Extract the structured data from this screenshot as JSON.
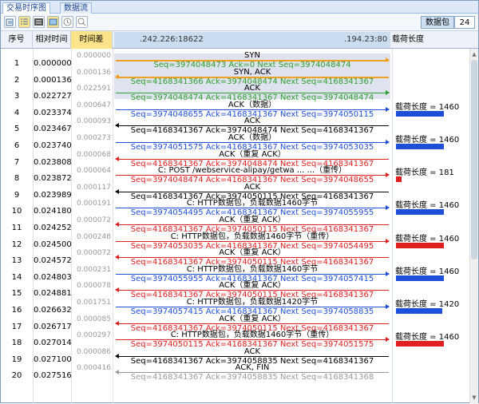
{
  "tabs": [
    {
      "label": "交易时序图",
      "active": true
    },
    {
      "label": "数据流",
      "active": false
    }
  ],
  "toolbar": {
    "icons": [
      "export-icon",
      "list-icon",
      "hex-icon",
      "image-icon",
      "clock-icon",
      "search-icon"
    ],
    "packet_label": "数据包",
    "packet_count": "24"
  },
  "columns": {
    "seq": "序号",
    "rel_time": "相对时间",
    "delta_time": "时间差",
    "left_ip": ".242.226:18622",
    "right_ip": ".194.23:80",
    "payload": "载荷长度"
  },
  "colors": {
    "orange": "#f0a020",
    "green": "#2e9e2e",
    "blue": "#1f4fd8",
    "black": "#000000",
    "red": "#e02020",
    "gray": "#9a9a9a"
  },
  "rows": [
    {
      "no": "1",
      "rel": "0.000000",
      "delta": "0.000000"
    },
    {
      "no": "2",
      "rel": "0.000136",
      "delta": "0.000136"
    },
    {
      "no": "3",
      "rel": "0.022727",
      "delta": "0.022591"
    },
    {
      "no": "4",
      "rel": "0.023374",
      "delta": "0.000647"
    },
    {
      "no": "5",
      "rel": "0.023467",
      "delta": "0.000093"
    },
    {
      "no": "6",
      "rel": "0.023740",
      "delta": "0.000273"
    },
    {
      "no": "7",
      "rel": "0.023808",
      "delta": "0.000068"
    },
    {
      "no": "8",
      "rel": "0.023872",
      "delta": "0.000064"
    },
    {
      "no": "9",
      "rel": "0.023989",
      "delta": "0.000117"
    },
    {
      "no": "10",
      "rel": "0.024180",
      "delta": "0.000191"
    },
    {
      "no": "11",
      "rel": "0.024252",
      "delta": "0.000072"
    },
    {
      "no": "12",
      "rel": "0.024500",
      "delta": "0.000248"
    },
    {
      "no": "13",
      "rel": "0.024572",
      "delta": "0.000072"
    },
    {
      "no": "14",
      "rel": "0.024803",
      "delta": "0.000231"
    },
    {
      "no": "15",
      "rel": "0.024881",
      "delta": "0.000078"
    },
    {
      "no": "16",
      "rel": "0.026632",
      "delta": "0.001751"
    },
    {
      "no": "17",
      "rel": "0.026717",
      "delta": "0.000085"
    },
    {
      "no": "18",
      "rel": "0.027014",
      "delta": "0.000297"
    },
    {
      "no": "19",
      "rel": "0.027100",
      "delta": "0.000086"
    },
    {
      "no": "20",
      "rel": "0.027516",
      "delta": "0.000416"
    }
  ],
  "arrows": [
    {
      "dir": "right",
      "color": "orange",
      "top": "SYN",
      "bottom": "Seq=3974048473  Ack=0  Next Seq=3974048474",
      "bottom_color": "green"
    },
    {
      "dir": "left",
      "color": "orange",
      "top": "SYN, ACK",
      "bottom": "Seq=4168341366  Ack=3974048474  Next Seq=4168341367",
      "bottom_color": "green"
    },
    {
      "dir": "right",
      "color": "green",
      "top": "ACK",
      "bottom": "Seq=3974048474  Ack=4168341367  Next Seq=3974048474",
      "bottom_color": "green"
    },
    {
      "dir": "right",
      "color": "blue",
      "top": "ACK（数据）",
      "bottom": "Seq=3974048655  Ack=4168341367  Next Seq=3974050115",
      "bottom_color": "blue"
    },
    {
      "dir": "left",
      "color": "black",
      "top": "ACK",
      "bottom": "Seq=4168341367  Ack=3974048474  Next Seq=4168341367",
      "bottom_color": "black"
    },
    {
      "dir": "right",
      "color": "blue",
      "top": "ACK（数据）",
      "bottom": "Seq=3974051575  Ack=4168341367  Next Seq=3974053035",
      "bottom_color": "blue"
    },
    {
      "dir": "left",
      "color": "red",
      "top": "ACK（重复 ACK）",
      "bottom": "Seq=4168341367  Ack=3974048474  Next Seq=4168341367",
      "bottom_color": "red"
    },
    {
      "dir": "right",
      "color": "red",
      "top": "C: POST /webservice-alipay/getwa ... ...（重传）",
      "bottom": "Seq=3974048474  Ack=4168341367  Next Seq=3974048655",
      "bottom_color": "red"
    },
    {
      "dir": "left",
      "color": "black",
      "top": "ACK",
      "bottom": "Seq=4168341367  Ack=3974050115  Next Seq=4168341367",
      "bottom_color": "black"
    },
    {
      "dir": "right",
      "color": "blue",
      "top": "C: HTTP数据包，负载数据1460字节",
      "bottom": "Seq=3974054495  Ack=4168341367  Next Seq=3974055955",
      "bottom_color": "blue"
    },
    {
      "dir": "left",
      "color": "red",
      "top": "ACK（重复 ACK）",
      "bottom": "Seq=4168341367  Ack=3974050115  Next Seq=4168341367",
      "bottom_color": "red"
    },
    {
      "dir": "right",
      "color": "red",
      "top": "C: HTTP数据包，负载数据1460字节（重传）",
      "bottom": "Seq=3974053035  Ack=4168341367  Next Seq=3974054495",
      "bottom_color": "red"
    },
    {
      "dir": "left",
      "color": "red",
      "top": "ACK（重复 ACK）",
      "bottom": "Seq=4168341367  Ack=3974050115  Next Seq=4168341367",
      "bottom_color": "red"
    },
    {
      "dir": "right",
      "color": "blue",
      "top": "C: HTTP数据包，负载数据1460字节",
      "bottom": "Seq=3974055955  Ack=4168341367  Next Seq=3974057415",
      "bottom_color": "blue"
    },
    {
      "dir": "left",
      "color": "red",
      "top": "ACK（重复 ACK）",
      "bottom": "Seq=4168341367  Ack=3974050115  Next Seq=4168341367",
      "bottom_color": "red"
    },
    {
      "dir": "right",
      "color": "blue",
      "top": "C: HTTP数据包，负载数据1420字节",
      "bottom": "Seq=3974057415  Ack=4168341367  Next Seq=3974058835",
      "bottom_color": "blue"
    },
    {
      "dir": "left",
      "color": "red",
      "top": "ACK（重复 ACK）",
      "bottom": "Seq=4168341367  Ack=3974050115  Next Seq=4168341367",
      "bottom_color": "red"
    },
    {
      "dir": "right",
      "color": "red",
      "top": "C: HTTP数据包，负载数据1460字节（重传）",
      "bottom": "Seq=3974050115  Ack=4168341367  Next Seq=3974051575",
      "bottom_color": "red"
    },
    {
      "dir": "left",
      "color": "black",
      "top": "ACK",
      "bottom": "Seq=4168341367  Ack=3974058835  Next Seq=4168341367",
      "bottom_color": "black"
    },
    {
      "dir": "left",
      "color": "gray",
      "top": "ACK, FIN",
      "bottom": "Seq=4168341367  Ack=3974058835  Next Seq=4168341368",
      "bottom_color": "gray"
    }
  ],
  "payloads": [
    {
      "row": 4,
      "label": "载荷长度 = 1460",
      "fraction": 1.0,
      "color": "blue"
    },
    {
      "row": 6,
      "label": "载荷长度 = 1460",
      "fraction": 1.0,
      "color": "blue"
    },
    {
      "row": 8,
      "label": "载荷长度 = 181",
      "fraction": 0.124,
      "color": "red"
    },
    {
      "row": 10,
      "label": "载荷长度 = 1460",
      "fraction": 1.0,
      "color": "blue"
    },
    {
      "row": 12,
      "label": "载荷长度 = 1460",
      "fraction": 1.0,
      "color": "red"
    },
    {
      "row": 14,
      "label": "载荷长度 = 1460",
      "fraction": 1.0,
      "color": "blue"
    },
    {
      "row": 16,
      "label": "载荷长度 = 1420",
      "fraction": 0.973,
      "color": "blue"
    },
    {
      "row": 18,
      "label": "载荷长度 = 1460",
      "fraction": 1.0,
      "color": "red"
    }
  ]
}
